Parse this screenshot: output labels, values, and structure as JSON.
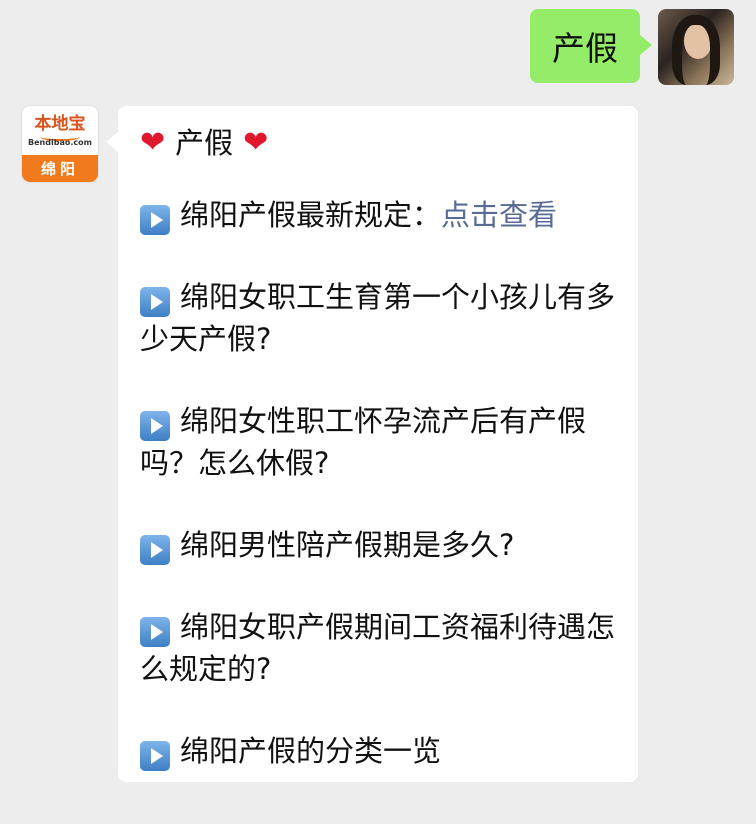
{
  "me": {
    "message": "产假"
  },
  "bot": {
    "logo": {
      "brand": "本地宝",
      "domain": "Bendibao.com",
      "city": "绵阳"
    },
    "heading": "产假",
    "items": [
      {
        "text": "绵阳产假最新规定：",
        "link": "点击查看"
      },
      {
        "text": "绵阳女职工生育第一个小孩儿有多少天产假?"
      },
      {
        "text": "绵阳女性职工怀孕流产后有产假吗？怎么休假?"
      },
      {
        "text": "绵阳男性陪产假期是多久?"
      },
      {
        "text": "绵阳女职产假期间工资福利待遇怎么规定的?"
      },
      {
        "text": "绵阳产假的分类一览"
      }
    ]
  },
  "colors": {
    "my_bubble": "#95ec69",
    "link": "#576b95",
    "background": "#ededed",
    "heart": "#e0182d"
  }
}
